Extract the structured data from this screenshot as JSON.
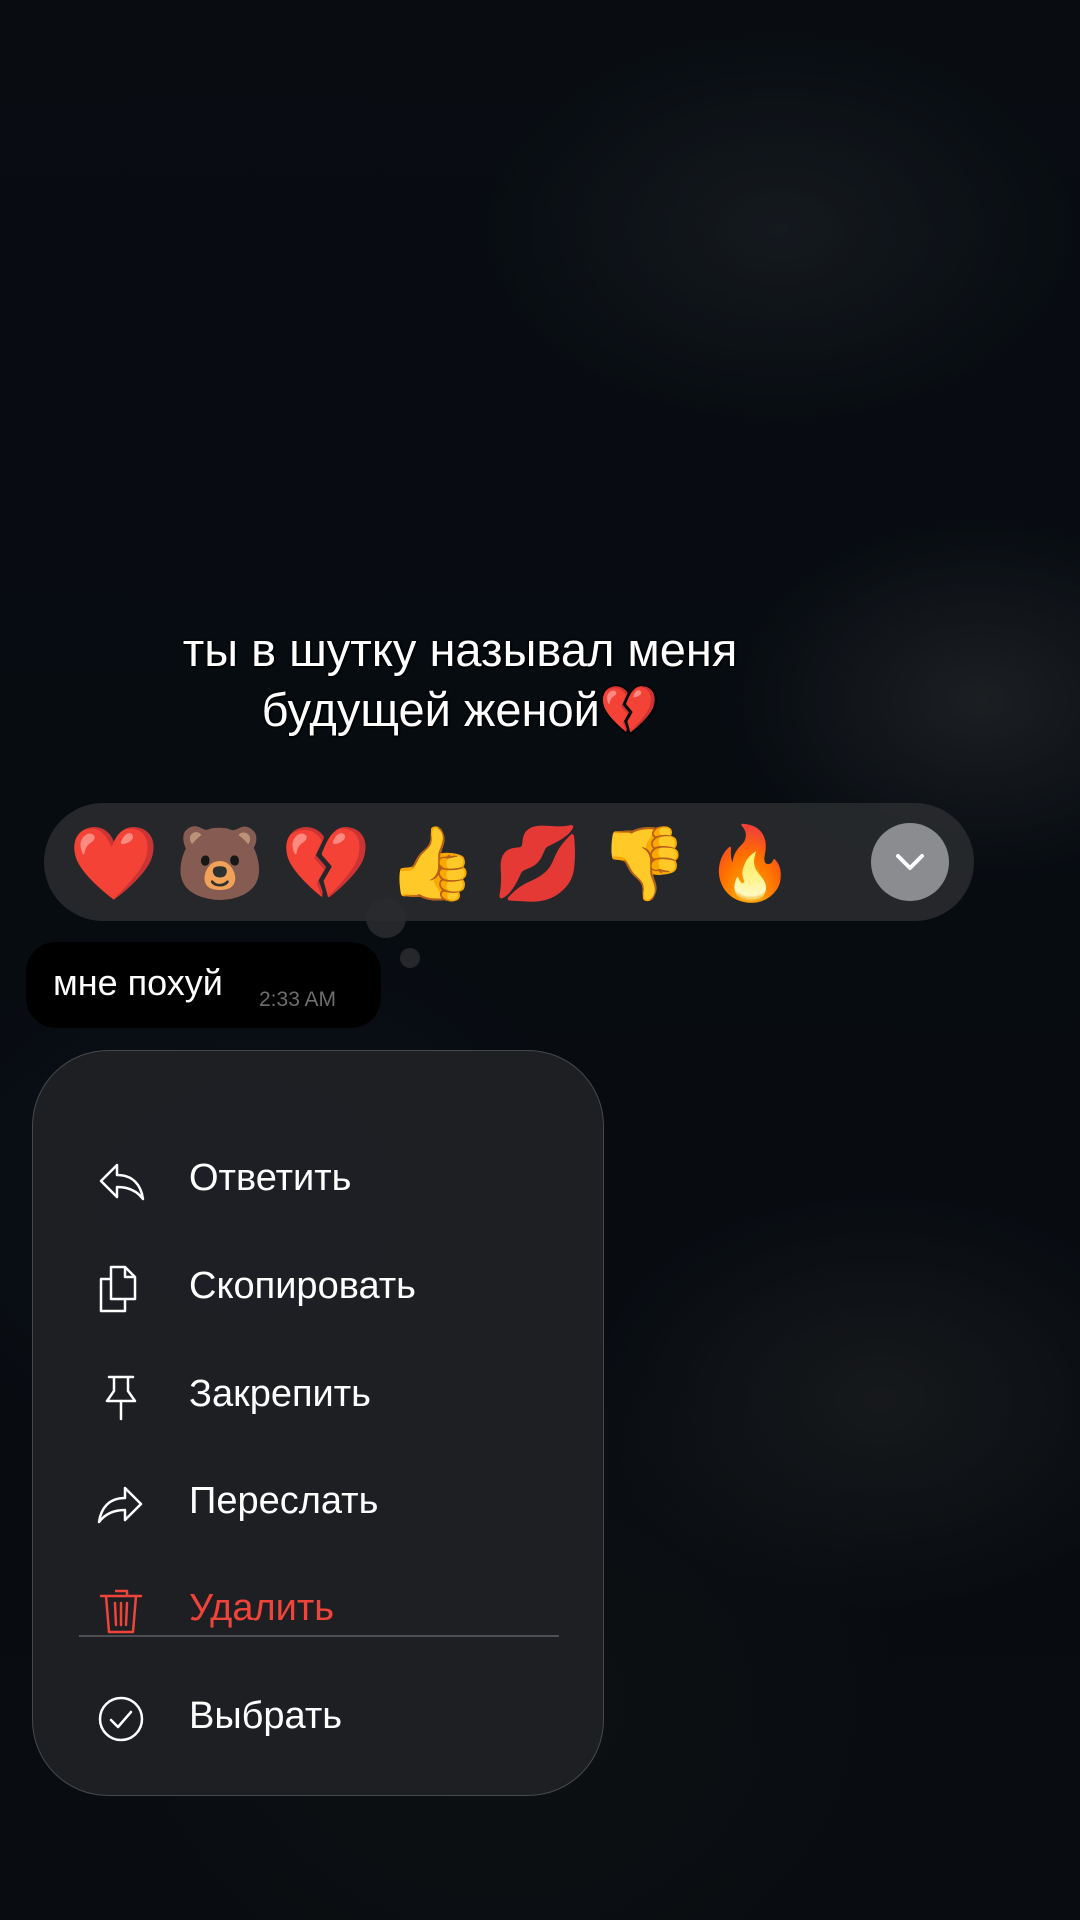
{
  "caption": {
    "line1": "ты в шутку называл меня",
    "line2": "будущей женой💔"
  },
  "reactions": [
    {
      "name": "heart",
      "glyph": "❤️"
    },
    {
      "name": "bear-sticker",
      "glyph": "🐻"
    },
    {
      "name": "broken-heart",
      "glyph": "💔"
    },
    {
      "name": "thumbs-up",
      "glyph": "👍"
    },
    {
      "name": "kiss",
      "glyph": "💋"
    },
    {
      "name": "thumbs-down",
      "glyph": "👎"
    },
    {
      "name": "fire",
      "glyph": "🔥"
    }
  ],
  "message": {
    "text": "мне похуй",
    "time": "2:33 AM"
  },
  "menu": {
    "items": [
      {
        "label": "Ответить",
        "icon": "reply-icon"
      },
      {
        "label": "Скопировать",
        "icon": "copy-icon"
      },
      {
        "label": "Закрепить",
        "icon": "pin-icon"
      },
      {
        "label": "Переслать",
        "icon": "forward-icon"
      },
      {
        "label": "Удалить",
        "icon": "trash-icon",
        "color": "#f0443a"
      },
      {
        "label": "Выбрать",
        "icon": "select-check-icon"
      }
    ]
  },
  "colors": {
    "danger": "#f0443a",
    "menu_bg": "#1e2024",
    "bubble_bg": "#000000"
  }
}
